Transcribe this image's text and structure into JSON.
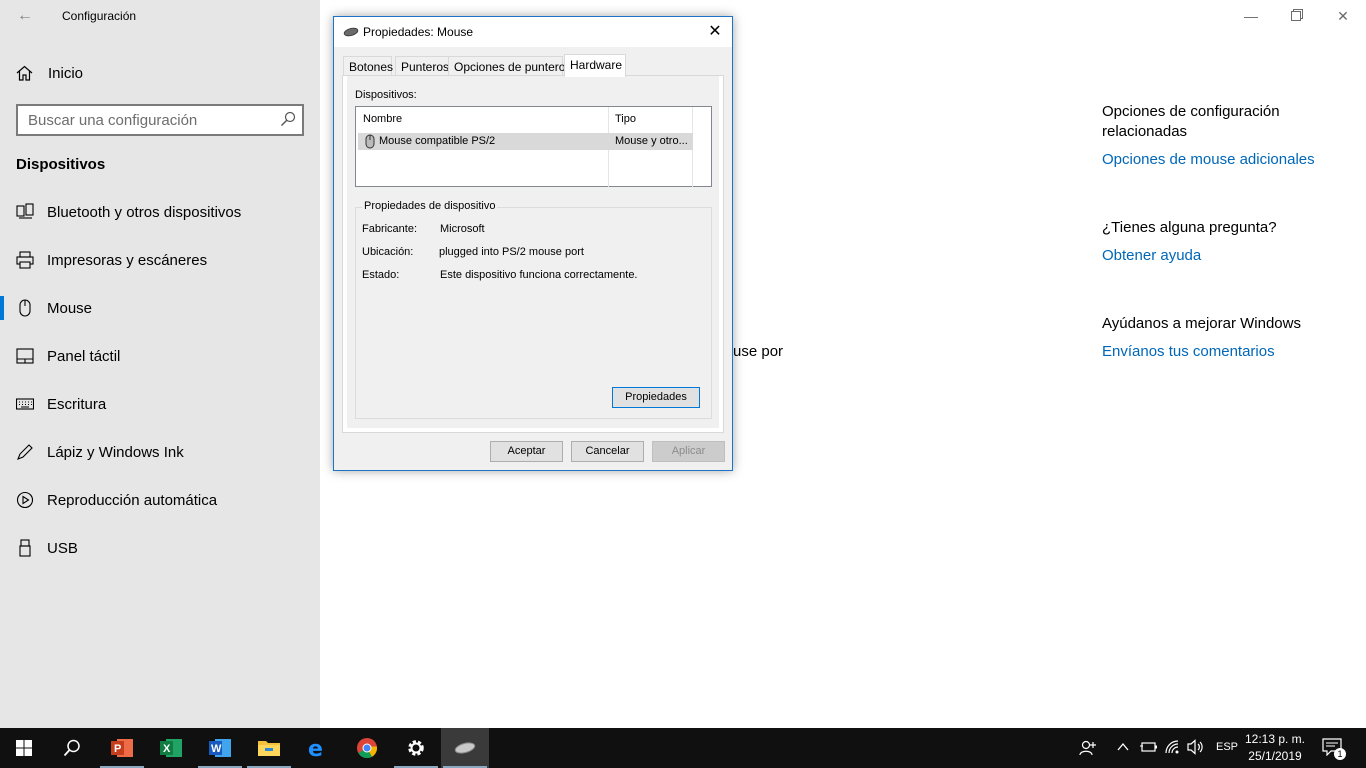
{
  "settings": {
    "app_title": "Configuración",
    "home_label": "Inicio",
    "search_placeholder": "Buscar una configuración",
    "section_title": "Dispositivos",
    "nav": [
      {
        "label": "Bluetooth y otros dispositivos",
        "icon": "bluetooth-devices-icon"
      },
      {
        "label": "Impresoras y escáneres",
        "icon": "printer-icon"
      },
      {
        "label": "Mouse",
        "icon": "mouse-icon",
        "active": true
      },
      {
        "label": "Panel táctil",
        "icon": "touchpad-icon"
      },
      {
        "label": "Escritura",
        "icon": "keyboard-icon"
      },
      {
        "label": "Lápiz y Windows Ink",
        "icon": "pen-icon"
      },
      {
        "label": "Reproducción automática",
        "icon": "autoplay-icon"
      },
      {
        "label": "USB",
        "icon": "usb-icon"
      }
    ],
    "partial_text": "use por",
    "related": {
      "heading": "Opciones de configuración relacionadas",
      "link": "Opciones de mouse adicionales",
      "question_heading": "¿Tienes alguna pregunta?",
      "help_link": "Obtener ayuda",
      "improve_heading": "Ayúdanos a mejorar Windows",
      "feedback_link": "Envíanos tus comentarios"
    },
    "accent_color": "#0078d7",
    "link_color": "#0067b8"
  },
  "dialog": {
    "title": "Propiedades: Mouse",
    "tabs": [
      "Botones",
      "Punteros",
      "Opciones de puntero",
      "Hardware"
    ],
    "selected_tab": "Hardware",
    "devices_label": "Dispositivos:",
    "columns": [
      "Nombre",
      "Tipo"
    ],
    "rows": [
      {
        "name": "Mouse compatible PS/2",
        "type": "Mouse y otro..."
      }
    ],
    "group_title": "Propiedades de dispositivo",
    "properties": [
      {
        "label": "Fabricante:",
        "value": "Microsoft"
      },
      {
        "label": "Ubicación:",
        "value": "plugged into PS/2 mouse port"
      },
      {
        "label": "Estado:",
        "value": "Este dispositivo funciona correctamente."
      }
    ],
    "properties_button": "Propiedades",
    "ok_button": "Aceptar",
    "cancel_button": "Cancelar",
    "apply_button": "Aplicar"
  },
  "taskbar": {
    "apps": [
      "windows-start-icon",
      "search-icon",
      "powerpoint-icon",
      "excel-icon",
      "word-icon",
      "file-explorer-icon",
      "edge-icon",
      "chrome-icon",
      "settings-icon",
      "mouse-properties-icon"
    ],
    "language": "ESP",
    "time": "12:13 p. m.",
    "date": "25/1/2019",
    "notification_count": "1"
  }
}
